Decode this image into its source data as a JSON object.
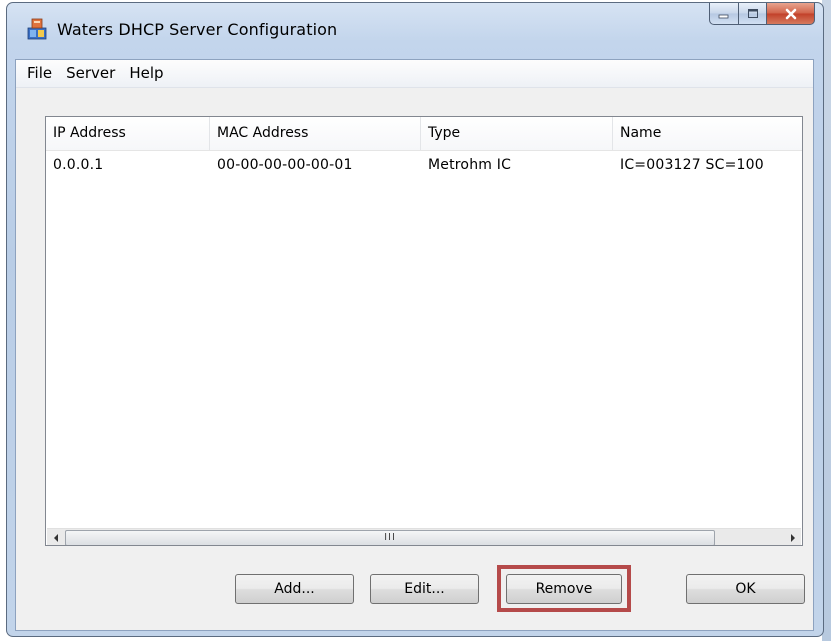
{
  "window": {
    "title": "Waters DHCP Server Configuration",
    "app_icon": "network-server-icon"
  },
  "caption_buttons": {
    "minimize": "minimize-icon",
    "maximize": "maximize-icon",
    "close": "close-icon"
  },
  "menubar": {
    "items": [
      "File",
      "Server",
      "Help"
    ]
  },
  "listview": {
    "columns": [
      "IP Address",
      "MAC Address",
      "Type",
      "Name"
    ],
    "rows": [
      {
        "ip": "0.0.0.1",
        "mac": "00-00-00-00-00-01",
        "type": "Metrohm IC",
        "name": "IC=003127 SC=100"
      }
    ],
    "scrollbar_grip": "III"
  },
  "buttons": {
    "add": "Add...",
    "edit": "Edit...",
    "remove": "Remove",
    "ok": "OK"
  },
  "colors": {
    "highlight": "#b54a4a",
    "close_button": "#c2412a"
  }
}
